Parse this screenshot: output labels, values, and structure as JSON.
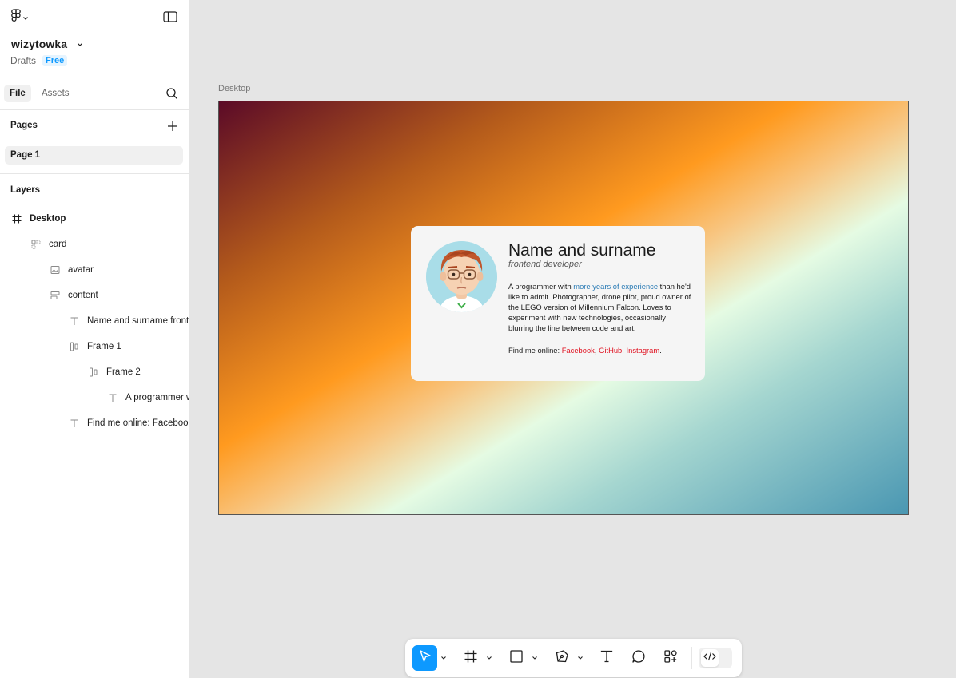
{
  "file": {
    "name": "wizytowka",
    "location": "Drafts",
    "plan": "Free"
  },
  "tabs": [
    {
      "label": "File",
      "active": true
    },
    {
      "label": "Assets",
      "active": false
    }
  ],
  "pages": {
    "header": "Pages",
    "items": [
      {
        "label": "Page 1",
        "selected": true
      }
    ]
  },
  "layers": {
    "header": "Layers",
    "items": [
      {
        "label": "Desktop",
        "icon": "frame-icon",
        "depth": 0
      },
      {
        "label": "card",
        "icon": "auto-layout-grid-icon",
        "depth": 1
      },
      {
        "label": "avatar",
        "icon": "image-icon",
        "depth": 2
      },
      {
        "label": "content",
        "icon": "auto-layout-vertical-icon",
        "depth": 2
      },
      {
        "label": "Name and surname frontend developer",
        "icon": "text-icon",
        "depth": 3
      },
      {
        "label": "Frame 1",
        "icon": "auto-layout-horizontal-icon",
        "depth": 3
      },
      {
        "label": "Frame 2",
        "icon": "auto-layout-horizontal-icon",
        "depth": 4
      },
      {
        "label": "A programmer with more years of experience",
        "icon": "text-icon",
        "depth": 5
      },
      {
        "label": "Find me online: Facebook, GitHub, Instagram.",
        "icon": "text-icon",
        "depth": 3
      }
    ]
  },
  "canvas": {
    "frame_label": "Desktop",
    "card": {
      "title": "Name and surname",
      "subtitle": "frontend developer",
      "desc_pre": "A programmer with ",
      "desc_link": "more years of experience",
      "desc_post": " than he'd like to admit. Photographer, drone pilot, proud owner of the LEGO version of Millennium Falcon. Loves to experiment with new technologies, occasionally blurring the line between code and art.",
      "find_label": "Find me online: ",
      "links": [
        "Facebook",
        "GitHub",
        "Instagram"
      ],
      "sep": ", ",
      "end": "."
    }
  },
  "toolbar": {
    "tools": [
      "move-tool",
      "frame-tool",
      "rectangle-tool",
      "pen-tool",
      "text-tool",
      "comment-tool",
      "actions-tool"
    ],
    "active_tool": "move-tool",
    "dev_mode": false
  },
  "colors": {
    "accent": "#0d99ff",
    "link_blue": "#2a7bb5",
    "link_red": "#e0101f"
  }
}
